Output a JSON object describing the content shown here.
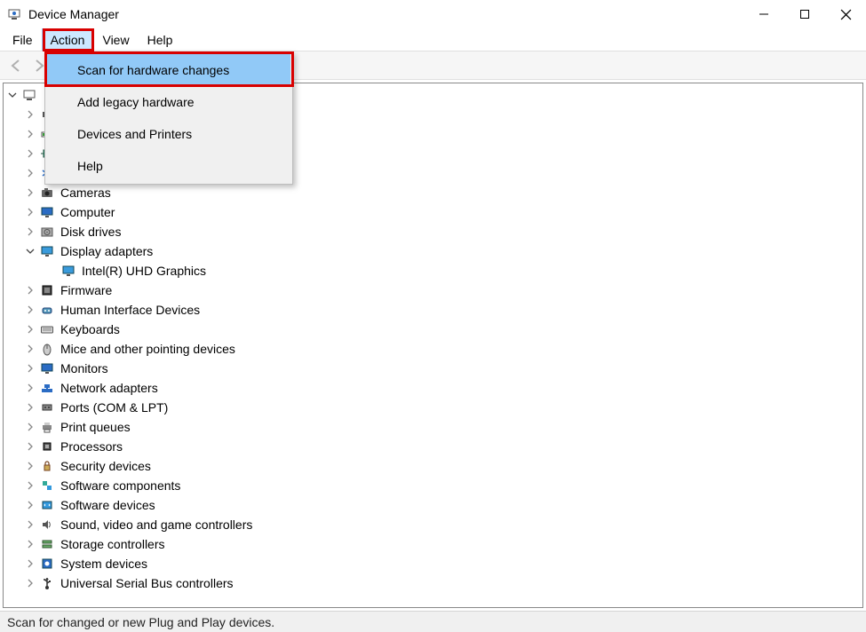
{
  "window": {
    "title": "Device Manager"
  },
  "menubar": {
    "items": [
      "File",
      "Action",
      "View",
      "Help"
    ],
    "open_index": 1
  },
  "dropdown": {
    "items": [
      {
        "label": "Scan for hardware changes",
        "highlight": true
      },
      {
        "label": "Add legacy hardware",
        "highlight": false
      },
      {
        "label": "Devices and Printers",
        "highlight": false
      },
      {
        "label": "Help",
        "highlight": false
      }
    ]
  },
  "tree": {
    "root": {
      "label": "",
      "expanded": true
    },
    "items": [
      {
        "label": "",
        "icon": "audio",
        "level": 1,
        "expanded": false,
        "expander": true
      },
      {
        "label": "",
        "icon": "battery",
        "level": 1,
        "expanded": false,
        "expander": true
      },
      {
        "label": "",
        "icon": "chip",
        "level": 1,
        "expanded": false,
        "expander": true
      },
      {
        "label": "",
        "icon": "bluetooth",
        "level": 1,
        "expanded": false,
        "expander": true
      },
      {
        "label": "Cameras",
        "icon": "camera",
        "level": 1,
        "expanded": false,
        "expander": true
      },
      {
        "label": "Computer",
        "icon": "monitor",
        "level": 1,
        "expanded": false,
        "expander": true
      },
      {
        "label": "Disk drives",
        "icon": "disk",
        "level": 1,
        "expanded": false,
        "expander": true
      },
      {
        "label": "Display adapters",
        "icon": "display",
        "level": 1,
        "expanded": true,
        "expander": true
      },
      {
        "label": "Intel(R) UHD Graphics",
        "icon": "display",
        "level": 2,
        "expanded": false,
        "expander": false
      },
      {
        "label": "Firmware",
        "icon": "firmware",
        "level": 1,
        "expanded": false,
        "expander": true
      },
      {
        "label": "Human Interface Devices",
        "icon": "hid",
        "level": 1,
        "expanded": false,
        "expander": true
      },
      {
        "label": "Keyboards",
        "icon": "keyboard",
        "level": 1,
        "expanded": false,
        "expander": true
      },
      {
        "label": "Mice and other pointing devices",
        "icon": "mouse",
        "level": 1,
        "expanded": false,
        "expander": true
      },
      {
        "label": "Monitors",
        "icon": "monitor",
        "level": 1,
        "expanded": false,
        "expander": true
      },
      {
        "label": "Network adapters",
        "icon": "network",
        "level": 1,
        "expanded": false,
        "expander": true
      },
      {
        "label": "Ports (COM & LPT)",
        "icon": "port",
        "level": 1,
        "expanded": false,
        "expander": true
      },
      {
        "label": "Print queues",
        "icon": "printer",
        "level": 1,
        "expanded": false,
        "expander": true
      },
      {
        "label": "Processors",
        "icon": "cpu",
        "level": 1,
        "expanded": false,
        "expander": true
      },
      {
        "label": "Security devices",
        "icon": "security",
        "level": 1,
        "expanded": false,
        "expander": true
      },
      {
        "label": "Software components",
        "icon": "swcomp",
        "level": 1,
        "expanded": false,
        "expander": true
      },
      {
        "label": "Software devices",
        "icon": "swdev",
        "level": 1,
        "expanded": false,
        "expander": true
      },
      {
        "label": "Sound, video and game controllers",
        "icon": "sound",
        "level": 1,
        "expanded": false,
        "expander": true
      },
      {
        "label": "Storage controllers",
        "icon": "storage",
        "level": 1,
        "expanded": false,
        "expander": true
      },
      {
        "label": "System devices",
        "icon": "system",
        "level": 1,
        "expanded": false,
        "expander": true
      },
      {
        "label": "Universal Serial Bus controllers",
        "icon": "usb",
        "level": 1,
        "expanded": false,
        "expander": true
      }
    ]
  },
  "statusbar": {
    "text": "Scan for changed or new Plug and Play devices."
  },
  "highlights": {
    "menu_action": true,
    "dropdown_first_item": true
  }
}
